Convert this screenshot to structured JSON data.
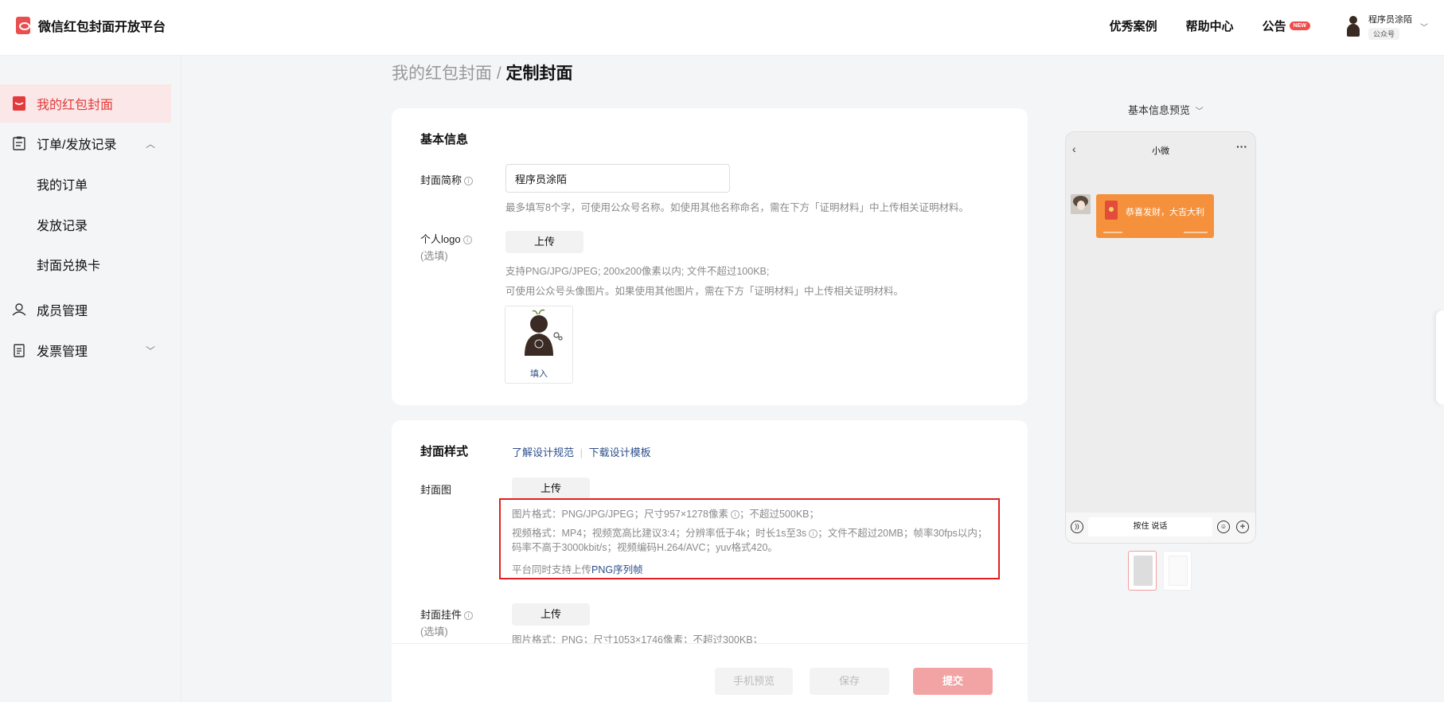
{
  "header": {
    "brand_name": "微信红包封面开放平台",
    "nav": [
      {
        "label": "优秀案例"
      },
      {
        "label": "帮助中心"
      },
      {
        "label": "公告",
        "badge": "NEW"
      }
    ],
    "user": {
      "name": "程序员涂陌",
      "role": "公众号"
    }
  },
  "sidebar": {
    "items": [
      {
        "label": "我的红包封面",
        "active": true,
        "icon": "red-packet-icon"
      },
      {
        "label": "订单/发放记录",
        "icon": "clipboard-icon",
        "expanded": true
      },
      {
        "label": "我的订单"
      },
      {
        "label": "发放记录"
      },
      {
        "label": "封面兑换卡"
      },
      {
        "label": "成员管理",
        "icon": "member-icon"
      },
      {
        "label": "发票管理",
        "icon": "invoice-icon",
        "expanded": false
      }
    ]
  },
  "breadcrumb": {
    "parent": "我的红包封面",
    "separator": " / ",
    "current": "定制封面"
  },
  "basic_info": {
    "title": "基本信息",
    "name_label": "封面简称",
    "name_value": "程序员涂陌",
    "name_hint": "最多填写8个字，可使用公众号名称。如使用其他名称命名，需在下方「证明材料」中上传相关证明材料。",
    "logo_label": "个人logo",
    "logo_optional": "(选填)",
    "upload_label": "上传",
    "logo_hint1": "支持PNG/JPG/JPEG; 200x200像素以内; 文件不超过100KB;",
    "logo_hint2": "可使用公众号头像图片。如果使用其他图片，需在下方「证明材料」中上传相关证明材料。",
    "logo_fill": "填入"
  },
  "cover_style": {
    "title": "封面样式",
    "link_spec": "了解设计规范",
    "link_template": "下载设计模板",
    "cover_label": "封面图",
    "upload_label": "上传",
    "cover_hint_image": "图片格式：PNG/JPG/JPEG；尺寸957×1278像素",
    "cover_hint_image_tail": "；不超过500KB；",
    "cover_hint_video_a": "视频格式：MP4；视频宽高比建议3:4；分辨率低于4k；时长1s至3s",
    "cover_hint_video_b": "；文件不超过20MB；帧率30fps以内；码率不高于3000kbit/s；视频编码H.264/AVC；yuv格式420。",
    "cover_hint_png_prefix": "平台同时支持上传",
    "cover_hint_png_link": "PNG序列帧",
    "pendant_label": "封面挂件",
    "pendant_optional": "(选填)",
    "pendant_hint": "图片格式：PNG；尺寸1053×1746像素；不超过300KB；"
  },
  "actions": {
    "preview": "手机预览",
    "save": "保存",
    "submit": "提交"
  },
  "preview": {
    "title": "基本信息预览",
    "chat_title": "小微",
    "redpack_text": "恭喜发财，大吉大利",
    "hold_to_talk": "按住 说话"
  },
  "colors": {
    "accent": "#e33b3b",
    "submit_disabled": "#f2a3a3",
    "link": "#2d4f8a",
    "highlight": "#e02020"
  }
}
